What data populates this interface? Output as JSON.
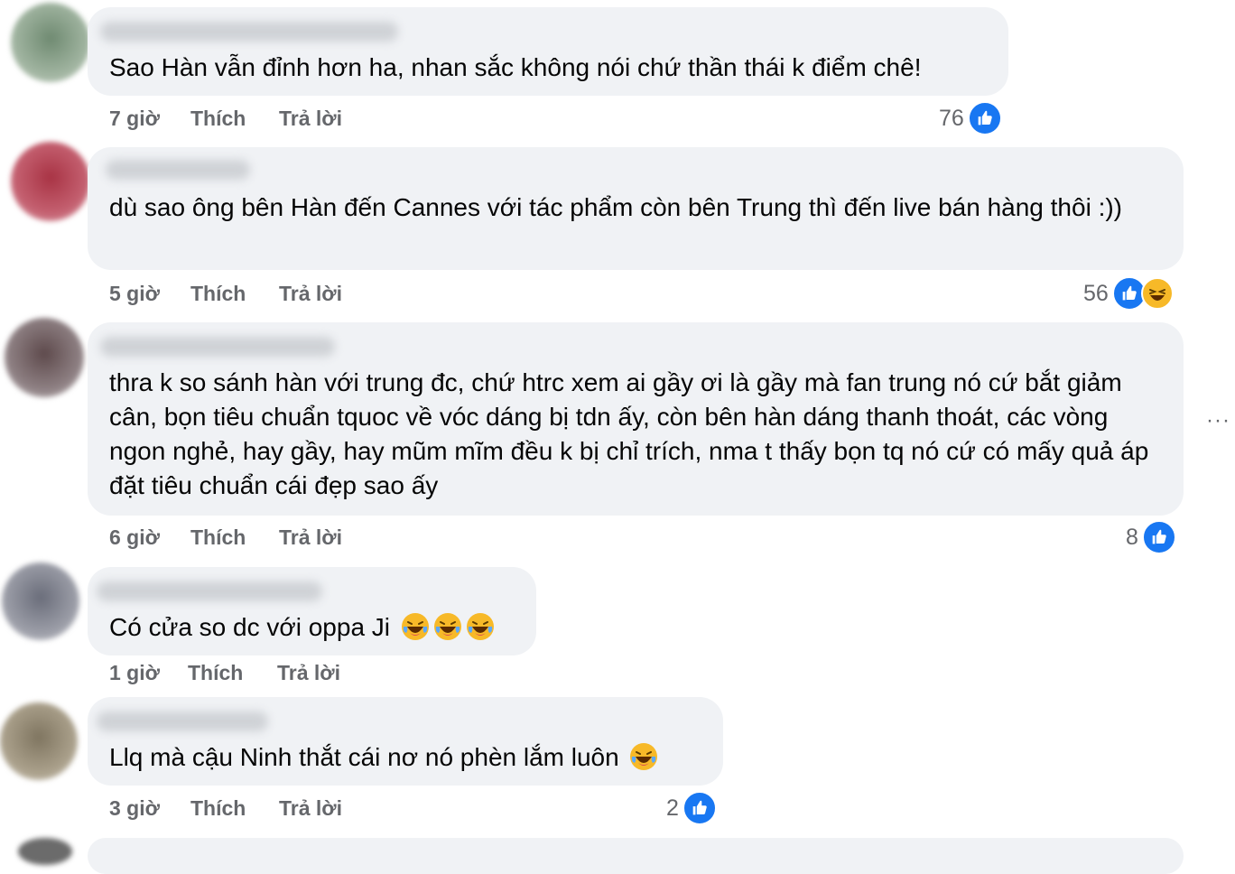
{
  "colors": {
    "bubble": "#f0f2f5",
    "meta_text": "#65676b",
    "like_blue": "#1877f2",
    "haha_yellow": "#f7b928"
  },
  "more_label": "···",
  "comments": [
    {
      "text": "Sao Hàn vẫn đỉnh hơn ha, nhan sắc không nói chứ thần thái k điểm chê!",
      "time": "7 giờ",
      "like_label": "Thích",
      "reply_label": "Trả lời",
      "reaction_count": "76",
      "reactions": [
        "like-icon"
      ]
    },
    {
      "text": "dù sao ông bên Hàn đến Cannes với tác phẩm còn bên Trung thì đến live bán hàng thôi :))",
      "time": "5 giờ",
      "like_label": "Thích",
      "reply_label": "Trả lời",
      "reaction_count": "56",
      "reactions": [
        "like-icon",
        "haha-icon"
      ]
    },
    {
      "text": "thra k so sánh hàn với trung đc, chứ htrc xem ai gầy ơi là gầy mà fan trung nó cứ bắt giảm cân, bọn tiêu chuẩn tquoc về vóc dáng bị tdn ấy, còn bên hàn dáng thanh thoát, các vòng ngon nghẻ, hay gầy, hay mũm mĩm đều k bị chỉ trích, nma t thấy bọn tq nó cứ có mấy quả áp đặt tiêu chuẩn cái đẹp sao ấy",
      "time": "6 giờ",
      "like_label": "Thích",
      "reply_label": "Trả lời",
      "reaction_count": "8",
      "reactions": [
        "like-icon"
      ]
    },
    {
      "text": "Có cửa so dc với oppa Ji",
      "emoji_count": 3,
      "emoji_name": "laughing-tears-emoji",
      "time": "1 giờ",
      "like_label": "Thích",
      "reply_label": "Trả lời"
    },
    {
      "text": "Llq mà cậu Ninh thắt cái nơ nó phèn lắm luôn",
      "emoji_count": 1,
      "emoji_name": "laughing-tears-emoji",
      "time": "3 giờ",
      "like_label": "Thích",
      "reply_label": "Trả lời",
      "reaction_count": "2",
      "reactions": [
        "like-icon"
      ]
    }
  ]
}
